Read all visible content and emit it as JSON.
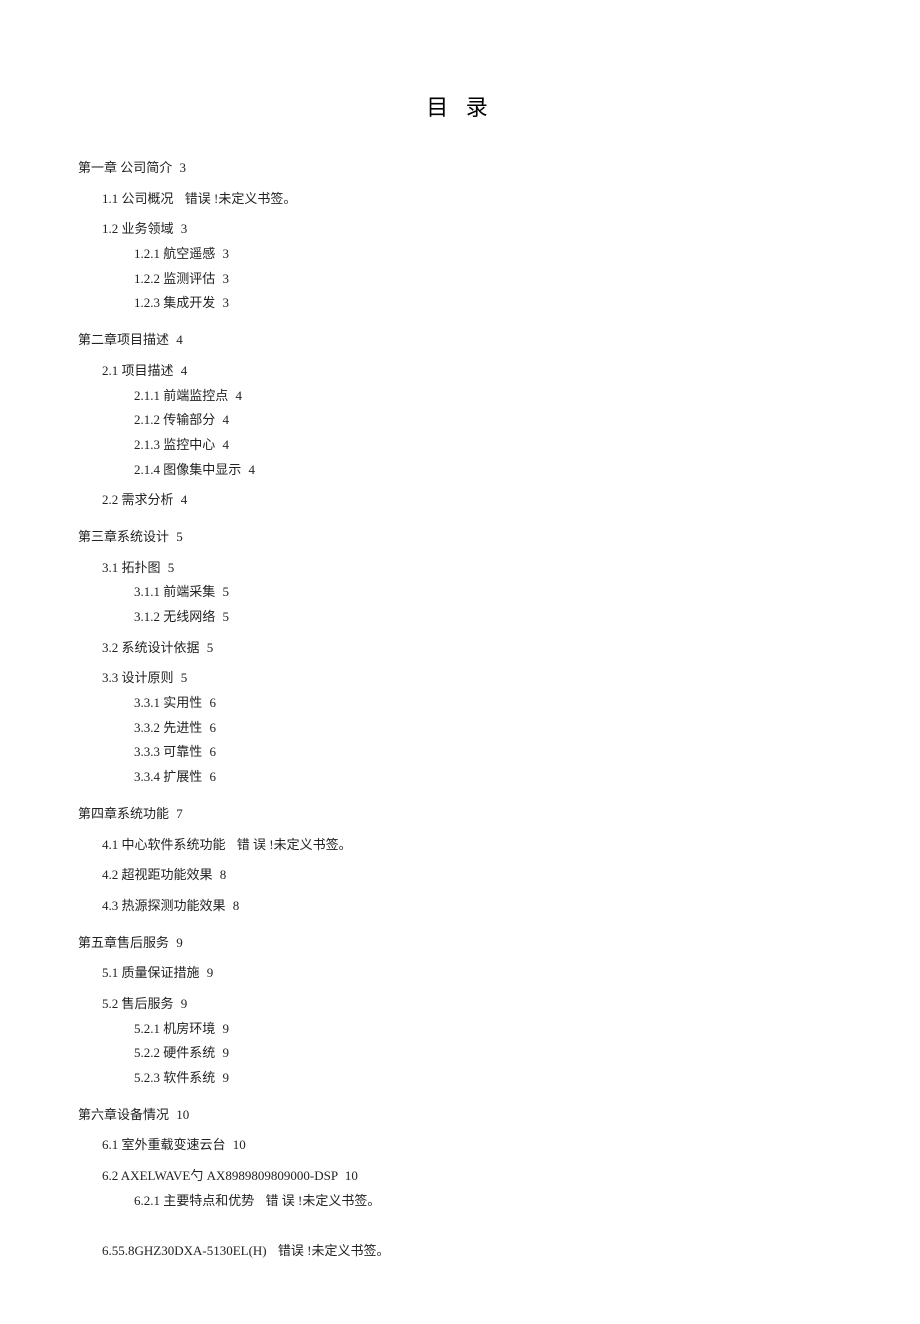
{
  "title": "目 录",
  "error_text": "错 误 !未定义书签。",
  "error_text2": "错误 !未定义书签。",
  "toc": {
    "ch1": {
      "heading": "第一章 公司简介",
      "page": "3",
      "s1_1": {
        "num": "1.1",
        "label": "公司概况"
      },
      "s1_2": {
        "num": "1.2",
        "label": "业务领域",
        "page": "3"
      },
      "s1_2_1": {
        "num": "1.2.1",
        "label": "航空遥感",
        "page": "3"
      },
      "s1_2_2": {
        "num": "1.2.2",
        "label": "监测评估",
        "page": "3"
      },
      "s1_2_3": {
        "num": "1.2.3",
        "label": "集成开发",
        "page": "3"
      }
    },
    "ch2": {
      "heading": "第二章项目描述",
      "page": "4",
      "s2_1": {
        "num": "2.1",
        "label": "项目描述",
        "page": "4"
      },
      "s2_1_1": {
        "num": "2.1.1",
        "label": "前端监控点",
        "page": "4"
      },
      "s2_1_2": {
        "num": "2.1.2",
        "label": "传输部分",
        "page": "4"
      },
      "s2_1_3": {
        "num": "2.1.3",
        "label": "监控中心",
        "page": "4"
      },
      "s2_1_4": {
        "num": "2.1.4",
        "label": "图像集中显示",
        "page": "4"
      },
      "s2_2": {
        "num": "2.2",
        "label": "需求分析",
        "page": "4"
      }
    },
    "ch3": {
      "heading": "第三章系统设计",
      "page": "5",
      "s3_1": {
        "num": "3.1",
        "label": "拓扑图",
        "page": "5"
      },
      "s3_1_1": {
        "num": "3.1.1",
        "label": "前端采集",
        "page": "5"
      },
      "s3_1_2": {
        "num": "3.1.2",
        "label": "无线网络",
        "page": "5"
      },
      "s3_2": {
        "num": "3.2",
        "label": "系统设计依据",
        "page": "5"
      },
      "s3_3": {
        "num": "3.3",
        "label": "设计原则",
        "page": "5"
      },
      "s3_3_1": {
        "num": "3.3.1",
        "label": "实用性",
        "page": "6"
      },
      "s3_3_2": {
        "num": "3.3.2",
        "label": "先进性",
        "page": "6"
      },
      "s3_3_3": {
        "num": "3.3.3",
        "label": "可靠性",
        "page": "6"
      },
      "s3_3_4": {
        "num": "3.3.4",
        "label": "扩展性",
        "page": "6"
      }
    },
    "ch4": {
      "heading": "第四章系统功能",
      "page": "7",
      "s4_1": {
        "num": "4.1",
        "label": "中心软件系统功能"
      },
      "s4_2": {
        "num": "4.2",
        "label": "超视距功能效果",
        "page": "8"
      },
      "s4_3": {
        "num": "4.3",
        "label": "热源探测功能效果",
        "page": "8"
      }
    },
    "ch5": {
      "heading": "第五章售后服务",
      "page": "9",
      "s5_1": {
        "num": "5.1",
        "label": "质量保证措施",
        "page": "9"
      },
      "s5_2": {
        "num": "5.2",
        "label": "售后服务",
        "page": "9"
      },
      "s5_2_1": {
        "num": "5.2.1",
        "label": "机房环境",
        "page": "9"
      },
      "s5_2_2": {
        "num": "5.2.2",
        "label": "硬件系统",
        "page": "9"
      },
      "s5_2_3": {
        "num": "5.2.3",
        "label": "软件系统",
        "page": "9"
      }
    },
    "ch6": {
      "heading": "第六章设备情况",
      "page": "10",
      "s6_1": {
        "num": "6.1",
        "label": "室外重载变速云台",
        "page": "10"
      },
      "s6_2": {
        "num": "6.2",
        "label": "AXELWAVE勺 AX8989809809000-DSP",
        "page": "10"
      },
      "s6_2_1": {
        "num": "6.2.1",
        "label": "主要特点和优势"
      },
      "s6_last": {
        "label": "6.55.8GHZ30DXA-5130EL(H)"
      }
    }
  }
}
